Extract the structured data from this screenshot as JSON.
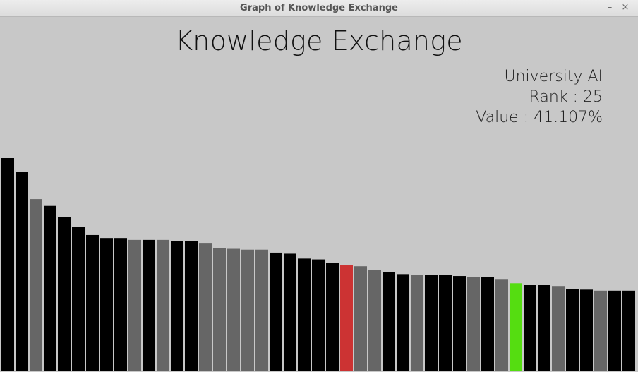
{
  "window": {
    "title": "Graph of Knowledge Exchange",
    "minimize_glyph": "–",
    "close_glyph": "×"
  },
  "info": {
    "name": "University AI",
    "rank_label": "Rank : 25",
    "value_label": "Value : 41.107%"
  },
  "colors": {
    "background": "#c8c8c8",
    "black": "#000000",
    "gray": "#666666",
    "red": "#cc3333",
    "green": "#55dd11"
  },
  "chart_data": {
    "type": "bar",
    "title": "Knowledge Exchange",
    "xlabel": "",
    "ylabel": "",
    "values": [
      100,
      93.6,
      80.7,
      77.5,
      72.4,
      67.6,
      63.8,
      62.4,
      62.4,
      61.5,
      61.5,
      61.5,
      61,
      61,
      60.1,
      57.8,
      57.3,
      56.9,
      56.9,
      55.5,
      55,
      52.7,
      52.3,
      50.5,
      49.5,
      49.1,
      47.2,
      46.3,
      45.4,
      45,
      45,
      45,
      44.5,
      44,
      44,
      43.1,
      41.1,
      40.2,
      40.2,
      39.8,
      38.5,
      38.1,
      37.6,
      37.6,
      37.6
    ],
    "colors": [
      "black",
      "black",
      "gray",
      "black",
      "black",
      "black",
      "black",
      "black",
      "black",
      "gray",
      "black",
      "gray",
      "black",
      "black",
      "gray",
      "gray",
      "gray",
      "gray",
      "gray",
      "black",
      "black",
      "black",
      "black",
      "black",
      "red",
      "gray",
      "gray",
      "black",
      "black",
      "gray",
      "black",
      "black",
      "black",
      "gray",
      "black",
      "gray",
      "green",
      "black",
      "black",
      "gray",
      "black",
      "black",
      "gray",
      "black",
      "black"
    ],
    "highlight_index": 36,
    "ylim": [
      0,
      100
    ],
    "grid": false
  }
}
